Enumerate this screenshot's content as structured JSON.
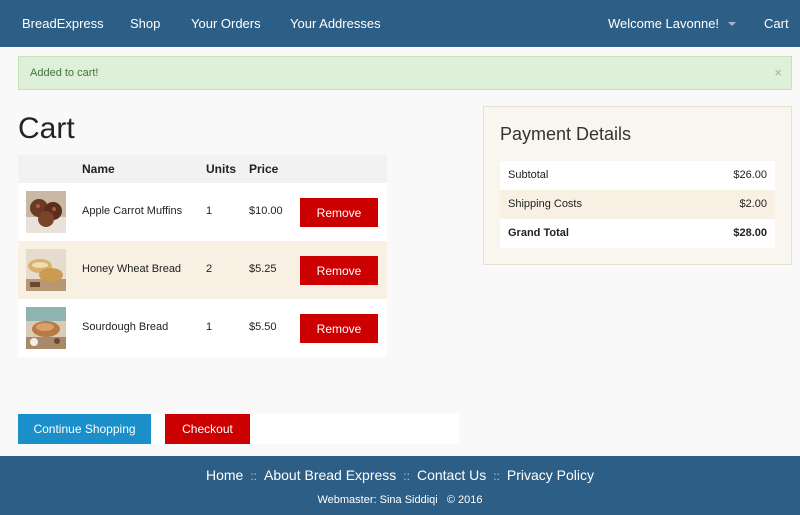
{
  "nav": {
    "brand": "BreadExpress",
    "links": [
      "Shop",
      "Your Orders",
      "Your Addresses"
    ],
    "welcome": "Welcome Lavonne!",
    "cart": "Cart"
  },
  "alert": {
    "message": "Added to cart!",
    "close": "×"
  },
  "page_title": "Cart",
  "cart": {
    "headers": [
      "Name",
      "Units",
      "Price"
    ],
    "items": [
      {
        "name": "Apple Carrot Muffins",
        "units": "1",
        "price": "$10.00",
        "remove": "Remove"
      },
      {
        "name": "Honey Wheat Bread",
        "units": "2",
        "price": "$5.25",
        "remove": "Remove"
      },
      {
        "name": "Sourdough Bread",
        "units": "1",
        "price": "$5.50",
        "remove": "Remove"
      }
    ]
  },
  "payment": {
    "title": "Payment Details",
    "rows": [
      {
        "label": "Subtotal",
        "value": "$26.00"
      },
      {
        "label": "Shipping Costs",
        "value": "$2.00"
      },
      {
        "label": "Grand Total",
        "value": "$28.00"
      }
    ]
  },
  "actions": {
    "continue": "Continue Shopping",
    "checkout": "Checkout"
  },
  "footer": {
    "links": [
      "Home",
      "About Bread Express",
      "Contact Us",
      "Privacy Policy"
    ],
    "separator": "::",
    "credit": "Webmaster: Sina Siddiqi   © 2016"
  },
  "colors": {
    "navbar": "#2d5e86",
    "accent_blue": "#1a8fc9",
    "danger": "#cc0000",
    "alert_bg": "#dff0d8",
    "row_alt": "#f9f0e4"
  }
}
